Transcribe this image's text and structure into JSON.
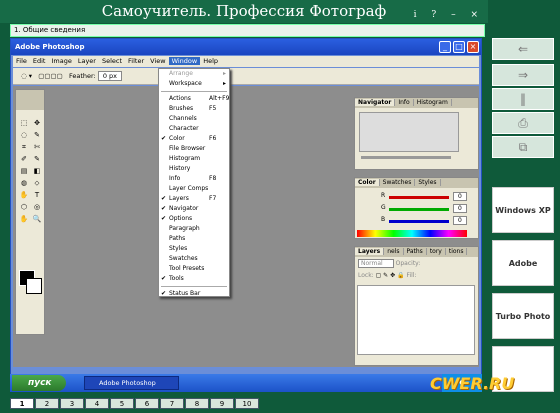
{
  "app": {
    "title": "Самоучитель. Профессия Фотограф",
    "controls": "i ? – ×",
    "section": "1. Общие сведения"
  },
  "photoshop": {
    "title": "Adobe Photoshop",
    "menu": [
      "File",
      "Edit",
      "Image",
      "Layer",
      "Select",
      "Filter",
      "View",
      "Window",
      "Help"
    ],
    "options": {
      "feather_label": "Feather:",
      "feather_value": "0 px"
    },
    "window_menu": [
      {
        "label": "Arrange",
        "arrow": "▸",
        "disabled": true
      },
      {
        "label": "Workspace",
        "arrow": "▸"
      },
      {
        "sep": true
      },
      {
        "label": "Actions",
        "shortcut": "Alt+F9"
      },
      {
        "label": "Brushes",
        "shortcut": "F5"
      },
      {
        "label": "Channels"
      },
      {
        "label": "Character"
      },
      {
        "label": "Color",
        "shortcut": "F6",
        "checked": true
      },
      {
        "label": "File Browser"
      },
      {
        "label": "Histogram"
      },
      {
        "label": "History"
      },
      {
        "label": "Info",
        "shortcut": "F8"
      },
      {
        "label": "Layer Comps"
      },
      {
        "label": "Layers",
        "shortcut": "F7",
        "checked": true
      },
      {
        "label": "Navigator",
        "checked": true
      },
      {
        "label": "Options",
        "checked": true
      },
      {
        "label": "Paragraph"
      },
      {
        "label": "Paths"
      },
      {
        "label": "Styles"
      },
      {
        "label": "Swatches"
      },
      {
        "label": "Tool Presets"
      },
      {
        "label": "Tools",
        "checked": true
      },
      {
        "sep": true
      },
      {
        "label": "Status Bar",
        "checked": true
      }
    ],
    "panels": {
      "nav_tabs": [
        "Navigator",
        "Info",
        "Histogram"
      ],
      "color_tabs": [
        "Color",
        "Swatches",
        "Styles"
      ],
      "color_channels": [
        {
          "ch": "R",
          "val": "0"
        },
        {
          "ch": "G",
          "val": "0"
        },
        {
          "ch": "B",
          "val": "0"
        }
      ],
      "layers_tabs": [
        "Layers",
        "nels",
        "Paths",
        "tory",
        "tions"
      ],
      "blend_mode": "Normal",
      "opacity_label": "Opacity:",
      "lock_label": "Lock:",
      "fill_label": "Fill:"
    }
  },
  "taskbar": {
    "start": "пуск",
    "task": "Adobe Photoshop"
  },
  "pages": [
    "1",
    "2",
    "3",
    "4",
    "5",
    "6",
    "7",
    "8",
    "9",
    "10"
  ],
  "sidebar": {
    "logos": [
      "Windows XP",
      "Adobe Photoshop CS",
      "Turbo Photo 4.1",
      ""
    ]
  },
  "watermark": "CWER.RU"
}
